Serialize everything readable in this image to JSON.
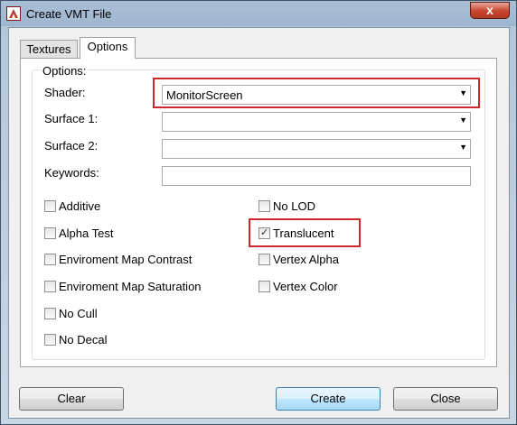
{
  "window": {
    "title": "Create VMT File",
    "close_glyph": "x"
  },
  "tabs": [
    {
      "label": "Textures",
      "active": false
    },
    {
      "label": "Options",
      "active": true
    }
  ],
  "options_group": {
    "title": "Options:",
    "shader": {
      "label": "Shader:",
      "value": "MonitorScreen"
    },
    "surface1": {
      "label": "Surface 1:",
      "value": ""
    },
    "surface2": {
      "label": "Surface 2:",
      "value": ""
    },
    "keywords": {
      "label": "Keywords:",
      "value": ""
    },
    "checkboxes_left": [
      {
        "label": "Additive",
        "checked": false
      },
      {
        "label": "Alpha Test",
        "checked": false
      },
      {
        "label": "Enviroment Map Contrast",
        "checked": false
      },
      {
        "label": "Enviroment Map Saturation",
        "checked": false
      },
      {
        "label": "No Cull",
        "checked": false
      },
      {
        "label": "No Decal",
        "checked": false
      }
    ],
    "checkboxes_right": [
      {
        "label": "No LOD",
        "checked": false
      },
      {
        "label": "Translucent",
        "checked": true
      },
      {
        "label": "Vertex Alpha",
        "checked": false
      },
      {
        "label": "Vertex Color",
        "checked": false
      }
    ]
  },
  "buttons": {
    "clear": "Clear",
    "create": "Create",
    "close": "Close"
  },
  "icons": {
    "app": "app-logo-icon",
    "dropdown": "chevron-down-icon",
    "check": "checkmark-icon"
  },
  "colors": {
    "highlight": "#d0262d",
    "close_button": "#c7432c"
  }
}
